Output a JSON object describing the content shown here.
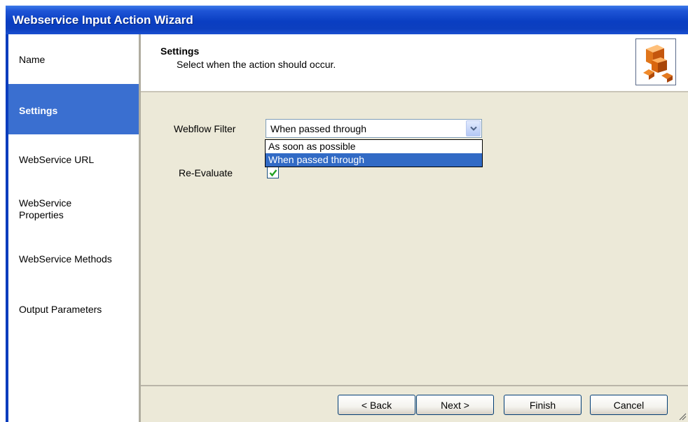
{
  "window": {
    "title": "Webservice Input Action Wizard"
  },
  "sidebar": {
    "items": [
      {
        "label": "Name",
        "active": false
      },
      {
        "label": "Settings",
        "active": true
      },
      {
        "label": "WebService URL",
        "active": false
      },
      {
        "label": "WebService Properties",
        "active": false
      },
      {
        "label": "WebService Methods",
        "active": false
      },
      {
        "label": "Output Parameters",
        "active": false
      }
    ]
  },
  "header": {
    "title": "Settings",
    "subtitle": "Select when the action should occur.",
    "icon": "cubes-icon"
  },
  "form": {
    "webflow_filter": {
      "label": "Webflow Filter",
      "value": "When passed through",
      "options": [
        "As soon as possible",
        "When passed through"
      ],
      "selected_index": 1,
      "expanded": true
    },
    "re_evaluate": {
      "label": "Re-Evaluate",
      "checked": true
    }
  },
  "footer": {
    "back_label": "< Back",
    "next_label": "Next >",
    "finish_label": "Finish",
    "cancel_label": "Cancel"
  },
  "colors": {
    "titlebar": "#0a3ec2",
    "sidebar_active": "#3a6fd0",
    "dropdown_selected": "#316ac5",
    "dialog_background": "#ece9d8",
    "checkmark": "#21a121"
  }
}
